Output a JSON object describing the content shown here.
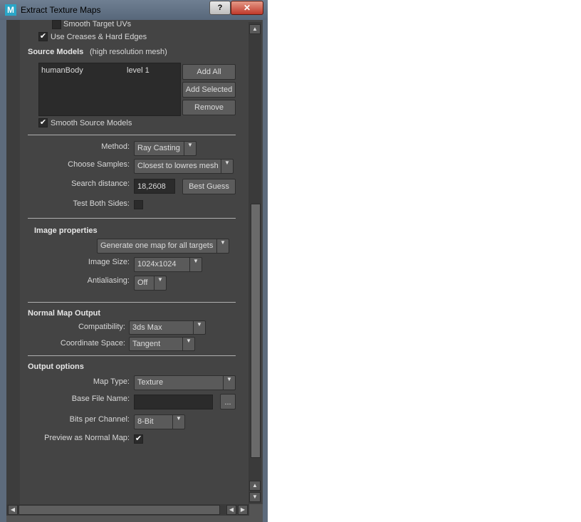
{
  "window": {
    "title": "Extract Texture Maps",
    "icon_letter": "M",
    "help_label": "?",
    "close_label": "✕"
  },
  "targets": {
    "smooth_uvs_label": "Smooth Target UVs",
    "creases_label": "Use Creases & Hard Edges",
    "creases_checked": true
  },
  "source": {
    "header": "Source Models",
    "subheader": "(high resolution mesh)",
    "list": [
      {
        "name": "humanBody",
        "level": "level 1"
      }
    ],
    "add_all": "Add All",
    "add_selected": "Add Selected",
    "remove": "Remove",
    "smooth_label": "Smooth Source Models",
    "smooth_checked": true
  },
  "sampling": {
    "method_label": "Method:",
    "method_value": "Ray Casting",
    "samples_label": "Choose Samples:",
    "samples_value": "Closest to lowres mesh",
    "distance_label": "Search distance:",
    "distance_value": "18,2608",
    "best_guess": "Best Guess",
    "both_sides_label": "Test Both Sides:"
  },
  "image": {
    "header": "Image properties",
    "generate_value": "Generate one map for all targets",
    "size_label": "Image Size:",
    "size_value": "1024x1024",
    "aa_label": "Antialiasing:",
    "aa_value": "Off"
  },
  "normal": {
    "header": "Normal Map Output",
    "compat_label": "Compatibility:",
    "compat_value": "3ds Max",
    "coord_label": "Coordinate Space:",
    "coord_value": "Tangent"
  },
  "output": {
    "header": "Output options",
    "map_type_label": "Map Type:",
    "map_type_value": "Texture",
    "base_name_label": "Base File Name:",
    "base_name_value": "",
    "browse_label": "...",
    "bits_label": "Bits per Channel:",
    "bits_value": "8-Bit",
    "preview_label": "Preview as Normal Map:",
    "preview_checked": true
  },
  "scroll": {
    "up": "▲",
    "down": "▼",
    "left": "◀",
    "right": "▶"
  }
}
